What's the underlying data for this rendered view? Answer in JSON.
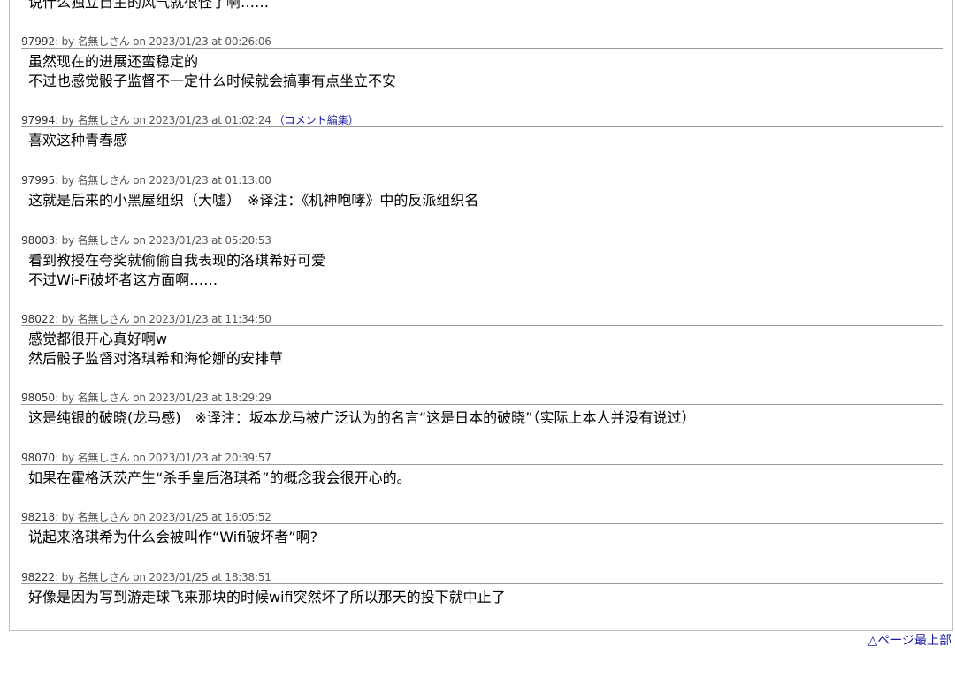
{
  "lead_text": "说什么独立自主的风气就很怪了啊……",
  "comments": [
    {
      "num": "97992",
      "meta": ": by 名無しさん on 2023/01/23 at 00:26:06",
      "edit": "",
      "lines": [
        "虽然现在的进展还蛮稳定的",
        "不过也感觉骰子监督不一定什么时候就会搞事有点坐立不安"
      ]
    },
    {
      "num": "97994",
      "meta": ": by 名無しさん on 2023/01/23 at 01:02:24",
      "edit": "（コメント編集）",
      "lines": [
        "喜欢这种青春感",
        ""
      ]
    },
    {
      "num": "97995",
      "meta": ": by 名無しさん on 2023/01/23 at 01:13:00",
      "edit": "",
      "lines": [
        "这就是后来的小黑屋组织（大嘘）　※译注：《机神咆哮》中的反派组织名",
        ""
      ]
    },
    {
      "num": "98003",
      "meta": ": by 名無しさん on 2023/01/23 at 05:20:53",
      "edit": "",
      "lines": [
        "看到教授在夸奖就偷偷自我表现的洛琪希好可爱",
        "不过Wi-Fi破坏者这方面啊……"
      ]
    },
    {
      "num": "98022",
      "meta": ": by 名無しさん on 2023/01/23 at 11:34:50",
      "edit": "",
      "lines": [
        "感觉都很开心真好啊w",
        "然后骰子监督对洛琪希和海伦娜的安排草"
      ]
    },
    {
      "num": "98050",
      "meta": ": by 名無しさん on 2023/01/23 at 18:29:29",
      "edit": "",
      "lines": [
        "这是纯银的破晓(龙马感)　※译注：坂本龙马被广泛认为的名言“这是日本的破晓”（实际上本人并没有说过）",
        ""
      ]
    },
    {
      "num": "98070",
      "meta": ": by 名無しさん on 2023/01/23 at 20:39:57",
      "edit": "",
      "lines": [
        "如果在霍格沃茨产生“杀手皇后洛琪希”的概念我会很开心的。",
        ""
      ]
    },
    {
      "num": "98218",
      "meta": ": by 名無しさん on 2023/01/25 at 16:05:52",
      "edit": "",
      "lines": [
        "说起来洛琪希为什么会被叫作“Wifi破坏者”啊?",
        ""
      ]
    },
    {
      "num": "98222",
      "meta": ": by 名無しさん on 2023/01/25 at 18:38:51",
      "edit": "",
      "lines": [
        "好像是因为写到游走球飞来那块的时候wifi突然坏了所以那天的投下就中止了",
        ""
      ]
    }
  ],
  "page_top_link": "△ページ最上部"
}
